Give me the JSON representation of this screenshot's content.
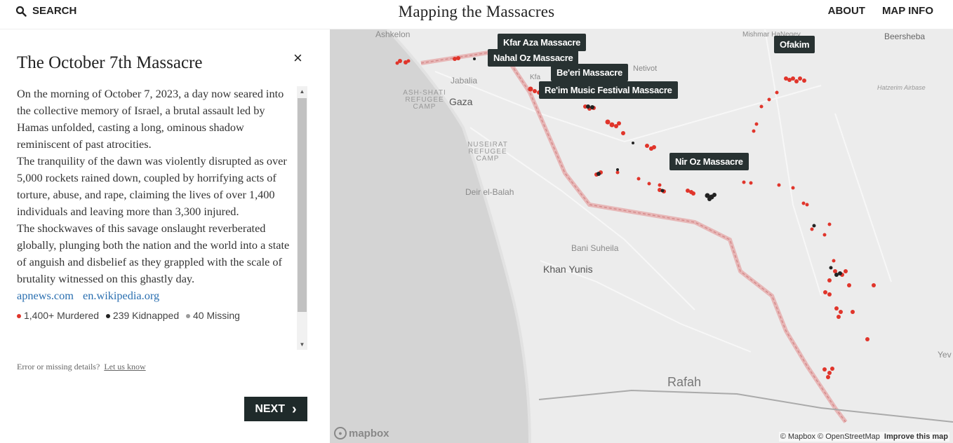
{
  "header": {
    "search_label": "SEARCH",
    "title": "Mapping the Massacres",
    "nav": [
      "ABOUT",
      "MAP INFO"
    ]
  },
  "sidebar": {
    "title": "The October 7th Massacre",
    "close_glyph": "×",
    "paragraphs": [
      "On the morning of October 7, 2023, a day now seared into the collective memory of Israel, a brutal assault led by Hamas unfolded, casting a long, ominous shadow reminiscent of past atrocities.",
      "The tranquility of the dawn was violently disrupted as over 5,000 rockets rained down, coupled by horrifying acts of torture, abuse, and rape, claiming the lives of over 1,400 individuals and leaving more than 3,300 injured.",
      "The shockwaves of this savage onslaught reverberated globally, plunging both the nation and the world into a state of anguish and disbelief as they grappled with the scale of brutality witnessed on this ghastly day."
    ],
    "links": [
      "apnews.com",
      "en.wikipedia.org"
    ],
    "stats": [
      {
        "label": "1,400+ Murdered",
        "color": "#e0352b"
      },
      {
        "label": "239 Kidnapped",
        "color": "#222222"
      },
      {
        "label": "40 Missing",
        "color": "#9a9a9a"
      }
    ],
    "report_text": "Error or missing details?",
    "report_link": "Let us know",
    "next_label": "NEXT",
    "next_glyph": "›"
  },
  "map": {
    "place_labels": [
      {
        "text": "Ashkelon",
        "style": "lbl"
      },
      {
        "text": "Mishmar HaNegev",
        "style": "lbl"
      },
      {
        "text": "Beersheba",
        "style": "lbl"
      },
      {
        "text": "Netivot",
        "style": "lbl"
      },
      {
        "text": "Jabalia",
        "style": "lbl"
      },
      {
        "text": "ASH-SHATI REFUGEE CAMP",
        "style": "small"
      },
      {
        "text": "Gaza",
        "style": "big"
      },
      {
        "text": "Hatzerim Airbase",
        "style": "tiny"
      },
      {
        "text": "NUSEIRAT REFUGEE CAMP",
        "style": "small"
      },
      {
        "text": "Deir el-Balah",
        "style": "lbl"
      },
      {
        "text": "Bani Suheila",
        "style": "lbl"
      },
      {
        "text": "Khan Yunis",
        "style": "big"
      },
      {
        "text": "Rafah",
        "style": "city"
      },
      {
        "text": "Yev",
        "style": "lbl"
      },
      {
        "text": "Kfa",
        "style": "lbl"
      }
    ],
    "massacre_labels": [
      "Kfar Aza Massacre",
      "Nahal Oz Massacre",
      "Be'eri Massacre",
      "Re'im Music Festival Massacre",
      "Ofakim",
      "Nir Oz Massacre"
    ],
    "logo": "mapbox",
    "attribution": "© Mapbox © OpenStreetMap",
    "improve": "Improve this map",
    "colors": {
      "murdered": "#e0352b",
      "kidnapped": "#222222",
      "sea": "#d4d4d4",
      "land": "#ececec"
    }
  }
}
